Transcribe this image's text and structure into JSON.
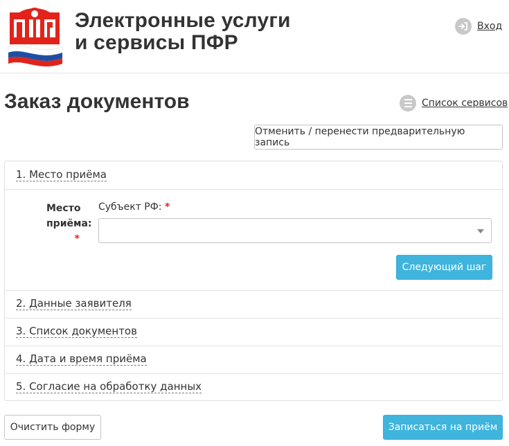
{
  "header": {
    "title_line1": "Электронные услуги",
    "title_line2": "и сервисы ПФР",
    "login_label": "Вход",
    "logo_text": "ПФР"
  },
  "page": {
    "title": "Заказ документов",
    "services_link": "Список сервисов",
    "cancel_button": "Отменить / перенести предварительную запись"
  },
  "steps": [
    {
      "label": "1. Место приёма"
    },
    {
      "label": "2. Данные заявителя"
    },
    {
      "label": "3. Список документов"
    },
    {
      "label": "4. Дата и время приёма"
    },
    {
      "label": "5. Согласие на обработку данных"
    }
  ],
  "form": {
    "place_label_line1": "Место",
    "place_label_line2": "приёма:",
    "required_mark": "*",
    "subject_label": "Субъект РФ:",
    "subject_value": "",
    "next_button": "Следующий шаг"
  },
  "footer": {
    "clear_button": "Очистить форму",
    "submit_button": "Записаться на приём"
  },
  "colors": {
    "accent": "#3fb5de",
    "required": "#d9232d",
    "logo_red": "#e2231a",
    "flag_blue": "#1f4fa3"
  }
}
